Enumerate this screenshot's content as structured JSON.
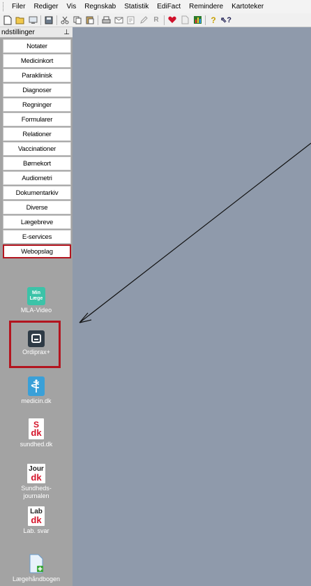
{
  "menu": {
    "items": [
      "Filer",
      "Rediger",
      "Vis",
      "Regnskab",
      "Statistik",
      "EdiFact",
      "Remindere",
      "Kartoteker"
    ]
  },
  "toolbar": {
    "icons": [
      "new-file-icon",
      "open-folder-icon",
      "screen-icon",
      "save-icon",
      "cut-icon",
      "copy-icon",
      "paste-icon",
      "print-icon",
      "mail-icon",
      "print-preview-icon",
      "edit-icon",
      "rx-icon",
      "heart-icon",
      "document-icon",
      "chart-icon",
      "help-icon",
      "context-help-icon"
    ]
  },
  "panel": {
    "title": "ndstillinger",
    "pin": "⊥",
    "buttons": [
      "Notater",
      "Medicinkort",
      "Paraklinisk",
      "Diagnoser",
      "Regninger",
      "Formularer",
      "Relationer",
      "Vaccinationer",
      "Børnekort",
      "Audiometri",
      "Dokumentarkiv",
      "Diverse",
      "Lægebreve",
      "E-services",
      "Webopslag"
    ],
    "selected": "Webopslag"
  },
  "launchers": {
    "mla": {
      "icon_text_1": "Min",
      "icon_text_2": "Læge",
      "label": "MLA-Video"
    },
    "ordiprax": {
      "label": "Ordiprax+"
    },
    "medicin": {
      "label": "medicin.dk"
    },
    "sundhed": {
      "icon_top": "S",
      "icon_bottom": "dk",
      "label": "sundhed.dk"
    },
    "journal": {
      "icon_top": "Jour",
      "icon_bottom": "dk",
      "label_1": "Sundheds-",
      "label_2": "journalen"
    },
    "lab": {
      "icon_top": "Lab",
      "icon_bottom": "dk",
      "label": "Lab. svar"
    },
    "haandbog": {
      "label": "Lægehåndbogen"
    }
  },
  "colors": {
    "highlight": "#b3151f",
    "workspace": "#8f9aab",
    "panel": "#a3a3a3"
  }
}
